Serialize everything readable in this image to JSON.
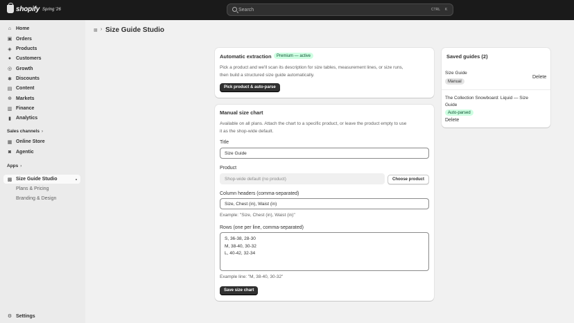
{
  "topbar": {
    "brand": "shopify",
    "edition": "Spring '26",
    "search_placeholder": "Search",
    "shortcut_ctrl": "CTRL",
    "shortcut_key": "K"
  },
  "sidebar": {
    "items": [
      {
        "label": "Home",
        "icon": "home-icon"
      },
      {
        "label": "Orders",
        "icon": "orders-icon"
      },
      {
        "label": "Products",
        "icon": "products-icon"
      },
      {
        "label": "Customers",
        "icon": "customers-icon"
      },
      {
        "label": "Growth",
        "icon": "growth-icon"
      },
      {
        "label": "Discounts",
        "icon": "discounts-icon"
      },
      {
        "label": "Content",
        "icon": "content-icon"
      },
      {
        "label": "Markets",
        "icon": "markets-icon"
      },
      {
        "label": "Finance",
        "icon": "finance-icon"
      },
      {
        "label": "Analytics",
        "icon": "analytics-icon"
      }
    ],
    "sales_channels_label": "Sales channels",
    "channels": [
      {
        "label": "Online Store",
        "icon": "store-icon"
      },
      {
        "label": "Agentic",
        "icon": "agentic-icon"
      }
    ],
    "apps_label": "Apps",
    "app": {
      "label": "Size Guide Studio",
      "icon": "app-icon"
    },
    "app_subitems": [
      "Plans & Pricing",
      "Branding & Design"
    ],
    "settings_label": "Settings"
  },
  "page": {
    "title": "Size Guide Studio"
  },
  "auto_card": {
    "title": "Automatic extraction",
    "badge": "Premium — active",
    "description_line1": "Pick a product and we'll scan its description for size tables, measurement lines, or size runs,",
    "description_line2": "then build a structured size guide automatically.",
    "button": "Pick product & auto-parse"
  },
  "manual_card": {
    "title": "Manual size chart",
    "description_line1": "Available on all plans. Attach the chart to a specific product, or leave the product empty to use",
    "description_line2": "it as the shop-wide default.",
    "title_label": "Title",
    "title_value": "Size Guide",
    "product_label": "Product",
    "product_value": "Shop-wide default (no product)",
    "choose_product": "Choose product",
    "columns_label": "Column headers (comma-separated)",
    "columns_value": "Size, Chest (in), Waist (in)",
    "columns_help": "Example: \"Size, Chest (in), Waist (in)\"",
    "rows_label": "Rows (one per line, comma-separated)",
    "rows": [
      "S, 36-38, 28-30",
      "M, 38-40, 30-32",
      "L, 40-42, 32-34"
    ],
    "rows_help": "Example line: \"M, 38-40, 30-32\"",
    "save_button": "Save size chart"
  },
  "saved_card": {
    "title": "Saved guides (2)",
    "guides": [
      {
        "name": "Size Guide",
        "badge": "Manual",
        "action": "Delete"
      },
      {
        "name_line1": "The Collection Snowboard: Liquid — Size",
        "name_line2": "Guide",
        "badge": "Auto-parsed",
        "action": "Delete"
      }
    ]
  }
}
